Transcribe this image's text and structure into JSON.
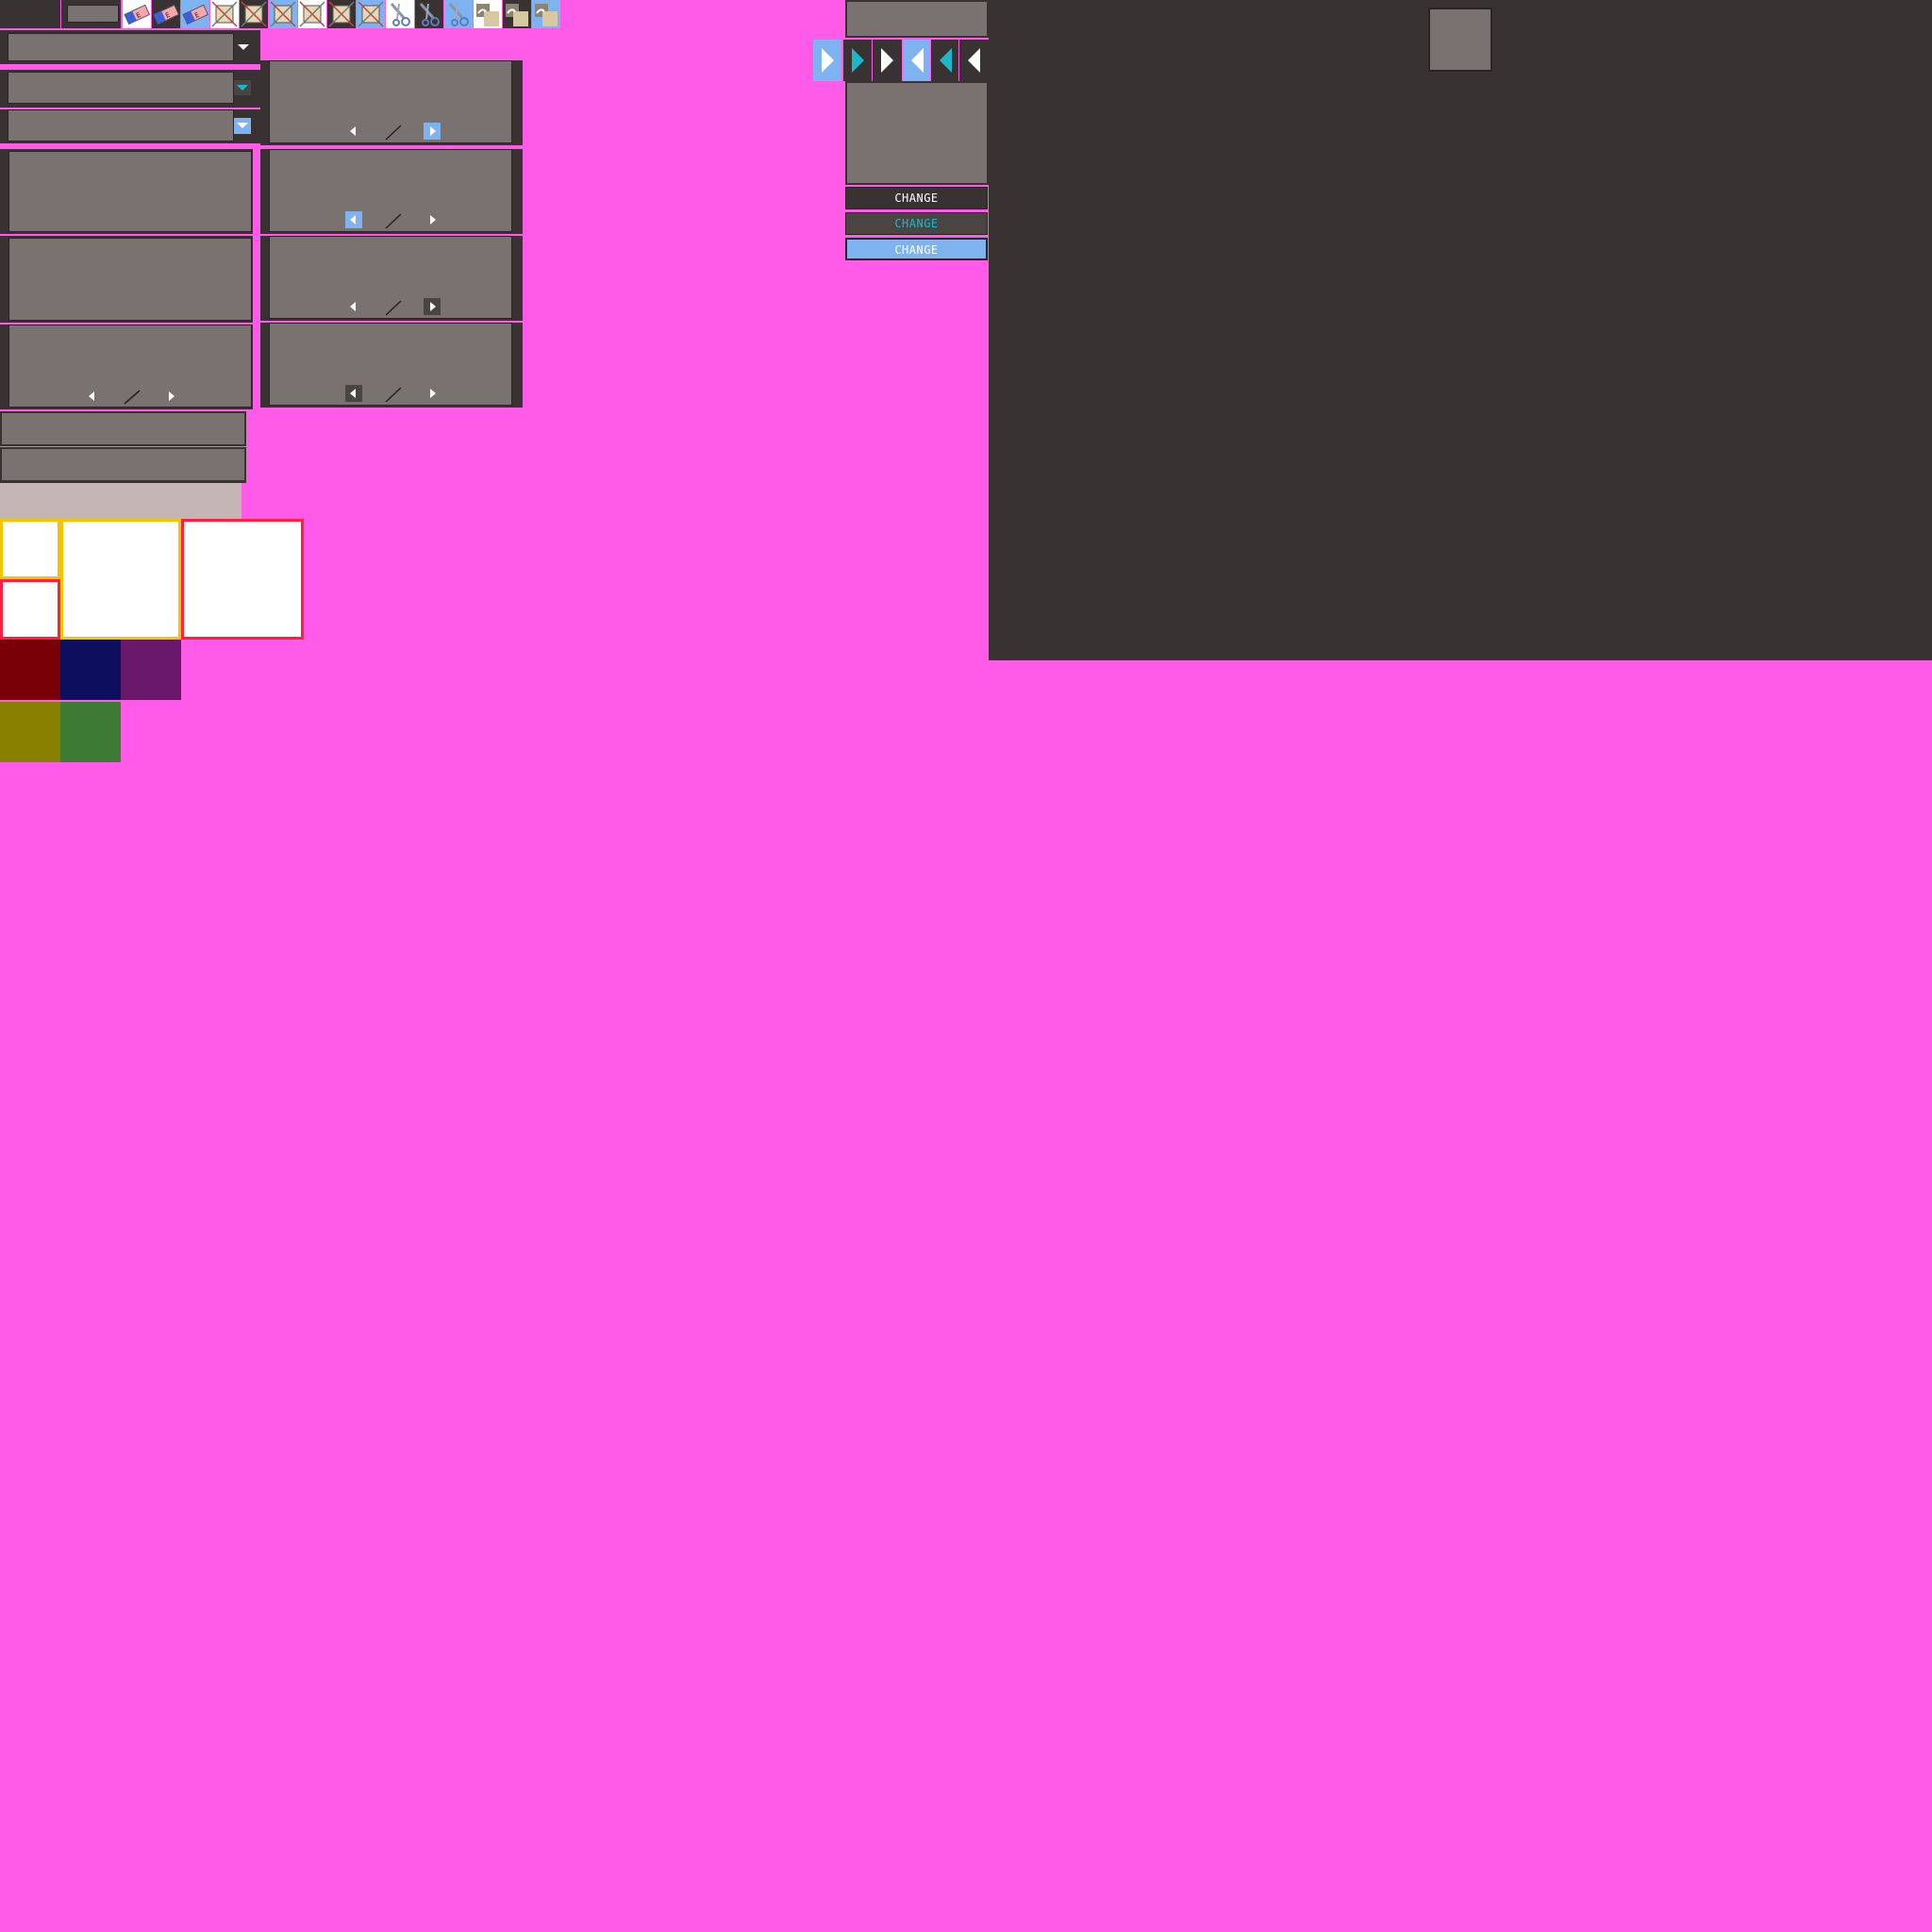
{
  "buttons": {
    "change_normal": "CHANGE",
    "change_hover": "CHANGE",
    "change_pressed": "CHANGE"
  },
  "toolbar": {
    "icons": [
      "eraser-icon",
      "eraser-icon",
      "eraser-icon",
      "cut-icon",
      "cut-icon",
      "cut-icon",
      "cut-icon",
      "cut-icon",
      "cut-icon",
      "scissors-icon",
      "scissors-icon",
      "scissors-icon",
      "paste-icon",
      "paste-icon",
      "paste-icon"
    ]
  },
  "colors": {
    "background_key": "#ff5ae8",
    "panel_dark": "#383332",
    "panel_mid": "#7a7270",
    "accent_blue": "#7fb2f0",
    "accent_cyan": "#1ab8c8",
    "frame_yellow": "#f5c400",
    "frame_red": "#ff2040",
    "swatch_maroon": "#7a0008",
    "swatch_navy": "#0e0e5e",
    "swatch_purple": "#6a186a",
    "swatch_olive": "#8a8000",
    "swatch_green": "#3d7a34"
  }
}
